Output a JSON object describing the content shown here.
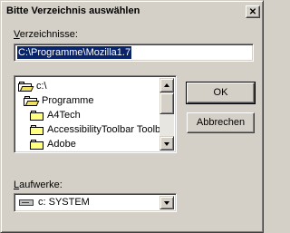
{
  "dialog": {
    "title": "Bitte Verzeichnis auswählen",
    "close_glyph": "✕"
  },
  "directories": {
    "label_hotkey": "V",
    "label_rest": "erzeichnisse:",
    "path_value": "C:\\Programme\\Mozilla1.7",
    "tree": [
      {
        "label": "c:\\",
        "level": 0,
        "open": true
      },
      {
        "label": "Programme",
        "level": 1,
        "open": true
      },
      {
        "label": "A4Tech",
        "level": 2,
        "open": false
      },
      {
        "label": "AccessibilityToolbar Toolba",
        "level": 2,
        "open": false
      },
      {
        "label": "Adobe",
        "level": 2,
        "open": false
      }
    ]
  },
  "buttons": {
    "ok": "OK",
    "cancel": "Abbrechen"
  },
  "drives": {
    "label_hotkey": "L",
    "label_rest": "aufwerke:",
    "selected": "c: SYSTEM"
  }
}
